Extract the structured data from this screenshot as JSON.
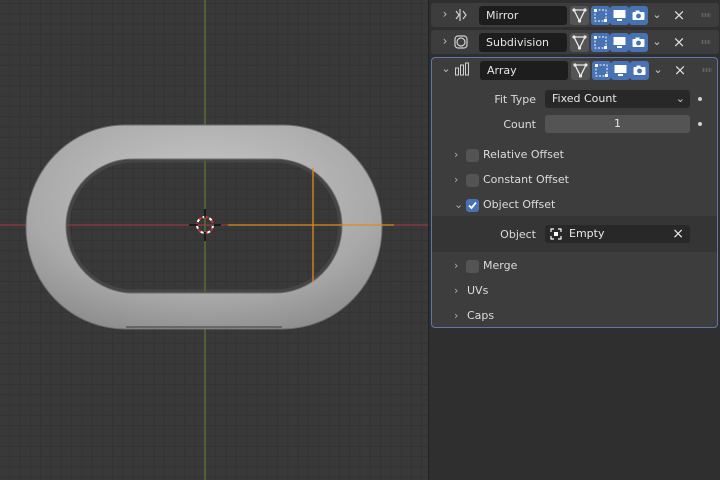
{
  "modifiers": [
    {
      "name": "Mirror",
      "icon": "mirror-modifier-icon",
      "expanded": false
    },
    {
      "name": "Subdivision",
      "icon": "subdivision-modifier-icon",
      "expanded": false
    },
    {
      "name": "Array",
      "icon": "array-modifier-icon",
      "expanded": true
    }
  ],
  "array": {
    "fit_type": {
      "label": "Fit Type",
      "value": "Fixed Count"
    },
    "count": {
      "label": "Count",
      "value": "1"
    },
    "relative_offset": {
      "label": "Relative Offset",
      "checked": false
    },
    "constant_offset": {
      "label": "Constant Offset",
      "checked": false
    },
    "object_offset": {
      "label": "Object Offset",
      "checked": true
    },
    "object": {
      "label": "Object",
      "value": "Empty"
    },
    "merge": {
      "label": "Merge",
      "checked": false
    },
    "uvs": {
      "label": "UVs"
    },
    "caps": {
      "label": "Caps"
    }
  },
  "colors": {
    "accent": "#4772b3",
    "selection_outline": "#e08a1e",
    "x_axis": "#a8393f",
    "y_axis": "#6a8a2a"
  }
}
